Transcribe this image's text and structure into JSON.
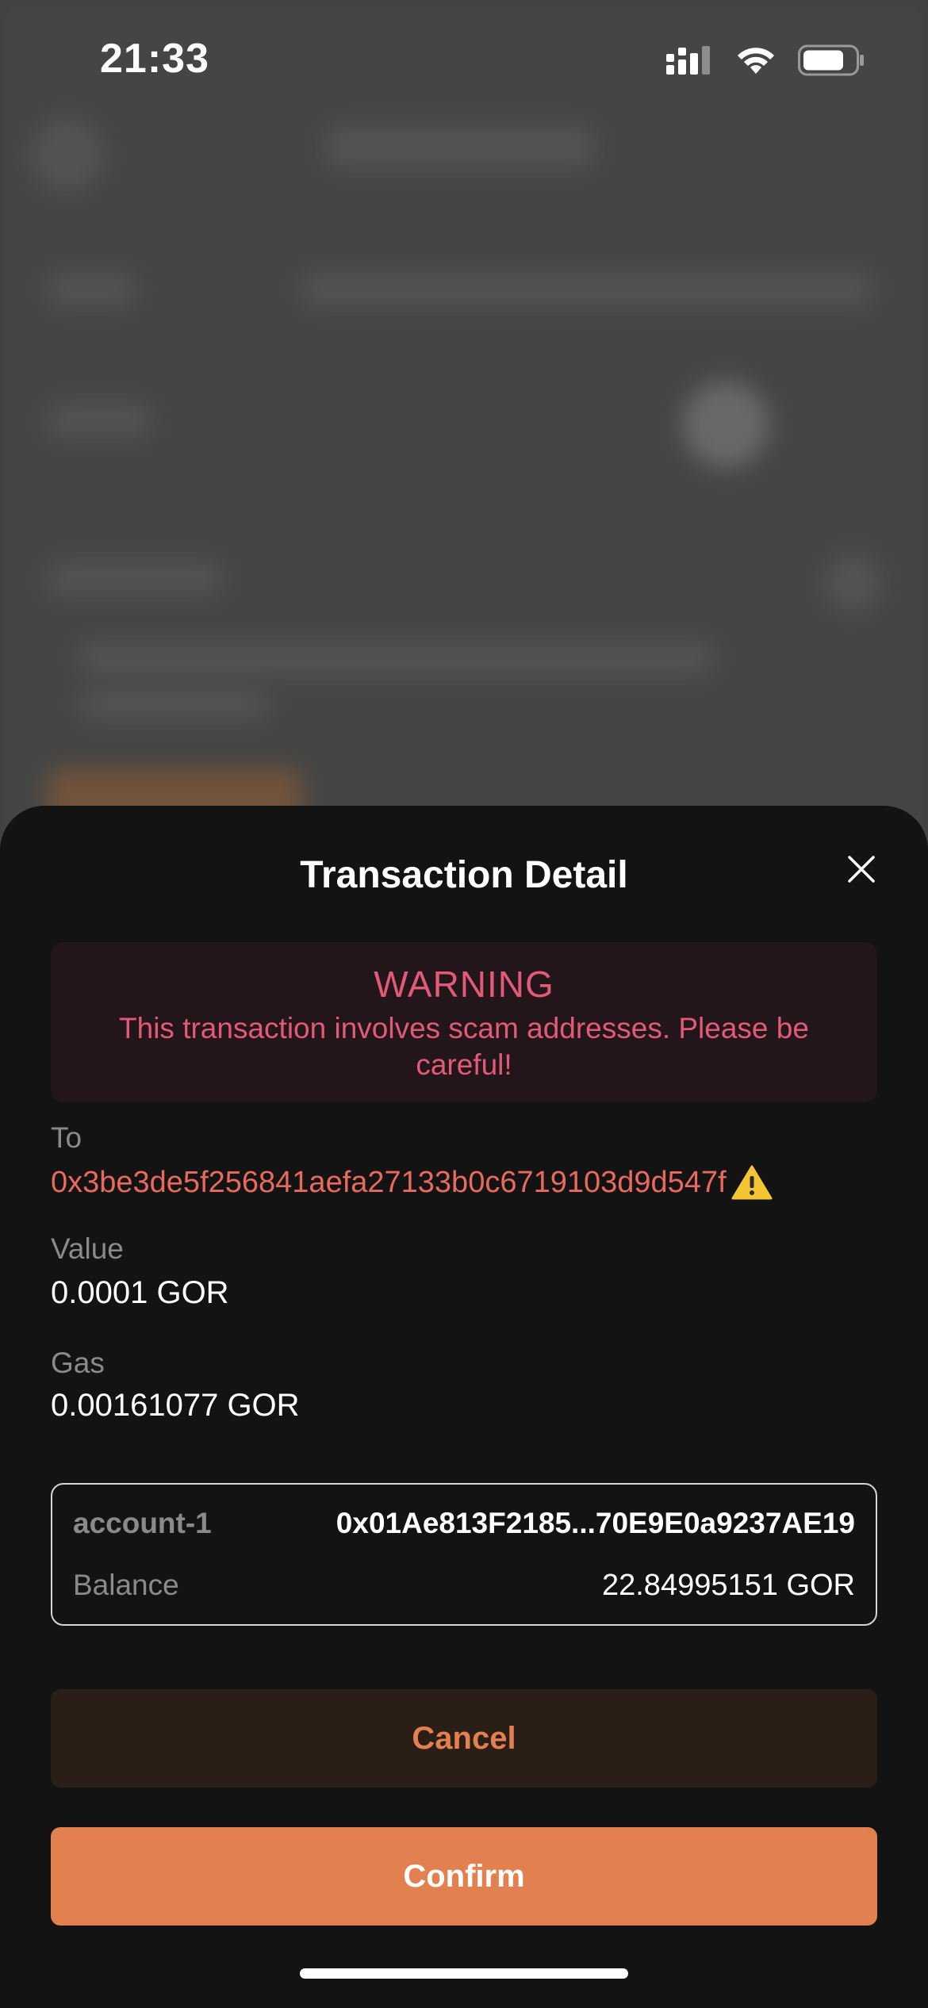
{
  "status_bar": {
    "time": "21:33"
  },
  "sheet": {
    "title": "Transaction Detail",
    "close_icon": "close-icon"
  },
  "warning": {
    "title": "WARNING",
    "message": "This transaction involves scam addresses. Please be careful!"
  },
  "to": {
    "label": "To",
    "address": "0x3be3de5f256841aefa27133b0c6719103d9d547f",
    "icon": "warning-triangle-icon"
  },
  "value": {
    "label": "Value",
    "amount": "0.0001 GOR"
  },
  "gas": {
    "label": "Gas",
    "amount": "0.00161077 GOR"
  },
  "account": {
    "name": "account-1",
    "address": "0x01Ae813F2185...70E9E0a9237AE19",
    "balance_label": "Balance",
    "balance": "22.84995151 GOR"
  },
  "buttons": {
    "cancel": "Cancel",
    "confirm": "Confirm"
  },
  "colors": {
    "accent": "#e2804f",
    "warning": "#e35a78",
    "address_warning": "#e86a5e",
    "sheet_background": "#131313"
  }
}
